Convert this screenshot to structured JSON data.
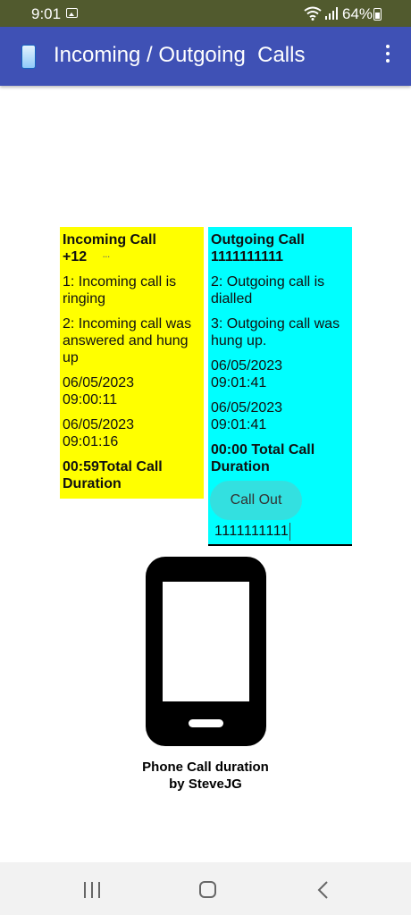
{
  "status_bar": {
    "time": "9:01",
    "battery": "64%"
  },
  "app_bar": {
    "title": "Incoming / Outgoing  Calls"
  },
  "incoming": {
    "title": "Incoming Call",
    "number": "+12",
    "step1": "1: Incoming call is ringing",
    "step2": "2: Incoming call was answered and hung up",
    "start_time": "06/05/2023 09:00:11",
    "end_time": "06/05/2023 09:01:16",
    "total": "00:59Total Call Duration",
    "color": "#ffff00"
  },
  "outgoing": {
    "title": "Outgoing Call",
    "number": "1111111111",
    "step2": "2: Outgoing call is dialled",
    "step3": "3: Outgoing call was hung up.",
    "start_time": "06/05/2023 09:01:41",
    "end_time": "06/05/2023 09:01:41",
    "total": "00:00 Total Call Duration",
    "call_button": "Call Out",
    "number_input_value": "1111111111",
    "color": "#00ffff"
  },
  "caption": {
    "line1": "Phone Call duration",
    "line2": "by SteveJG"
  },
  "icons": {
    "app": "smartphone-icon",
    "menu": "more-vert-icon",
    "illustration": "smartphone-icon",
    "nav_recent": "recent-apps-icon",
    "nav_home": "home-icon",
    "nav_back": "back-icon"
  },
  "colors": {
    "status_bar": "#515a2e",
    "app_bar": "#3f51b5",
    "call_button": "#33e0e0"
  }
}
